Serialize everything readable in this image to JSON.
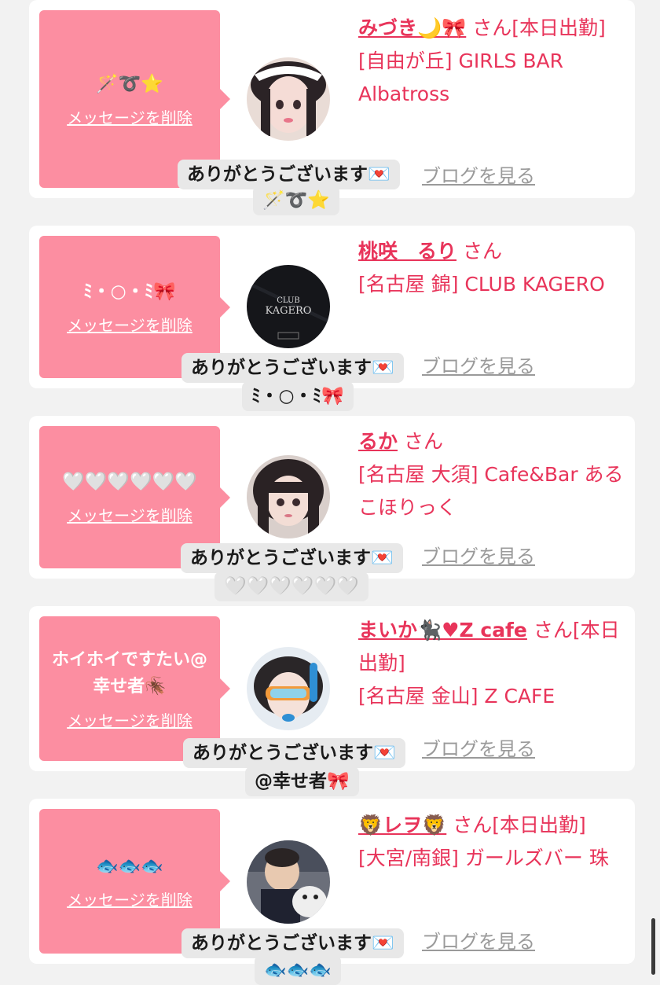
{
  "cards": [
    {
      "message": "🪄➰⭐",
      "delete_label": "メッセージを削除",
      "name": "みづき🌙🎀",
      "san": "さん",
      "status": "[本日出勤]",
      "location": "[自由が丘] GIRLS BAR Albatross",
      "blog_label": "ブログを見る",
      "thanks": "ありがとうございます💌",
      "thanks_sub": "🪄➰⭐"
    },
    {
      "message": "ﾐ・○・ﾐ🎀",
      "delete_label": "メッセージを削除",
      "name": "桃咲　るり",
      "san": "さん",
      "status": "",
      "location": "[名古屋 錦] CLUB KAGERO",
      "blog_label": "ブログを見る",
      "thanks": "ありがとうございます💌",
      "thanks_sub": "ﾐ・○・ﾐ🎀",
      "avatar_text_top": "CLUB",
      "avatar_text_main": "KAGERO"
    },
    {
      "message": "🤍🤍🤍🤍🤍🤍",
      "delete_label": "メッセージを削除",
      "name": "るか",
      "san": "さん",
      "status": "",
      "location": "[名古屋 大須] Cafe&Bar あるこほりっく",
      "blog_label": "ブログを見る",
      "thanks": "ありがとうございます💌",
      "thanks_sub": "🤍🤍🤍🤍🤍🤍"
    },
    {
      "message": "ホイホイですたい@幸せ者🪳",
      "delete_label": "メッセージを削除",
      "name": "まいか🐈‍⬛♥Z cafe",
      "san": "さん",
      "status": "[本日出勤]",
      "location": "[名古屋 金山] Z CAFE",
      "blog_label": "ブログを見る",
      "thanks": "ありがとうございます💌",
      "thanks_sub": "@幸せ者🎀"
    },
    {
      "message": "🐟🐟🐟",
      "delete_label": "メッセージを削除",
      "name": "🦁レヲ🦁",
      "san": "さん",
      "status": "[本日出勤]",
      "location": "[大宮/南銀] ガールズバー 珠",
      "blog_label": "ブログを見る",
      "thanks": "ありがとうございます💌",
      "thanks_sub": "🐟🐟🐟"
    }
  ],
  "colors": {
    "accent": "#e8345a",
    "message_box": "#fc8ea1",
    "link_gray": "#9a9a9a",
    "page_bg": "#f2f2f2"
  }
}
